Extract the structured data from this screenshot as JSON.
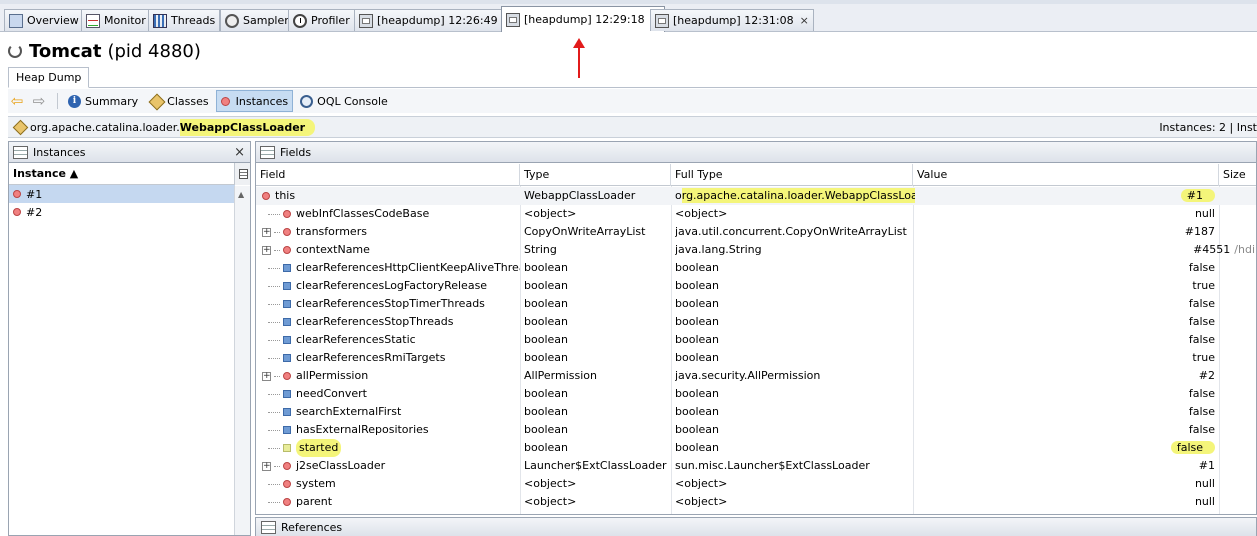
{
  "tabs": [
    {
      "label": "Overview",
      "icon": "overview-icon"
    },
    {
      "label": "Monitor",
      "icon": "monitor-icon"
    },
    {
      "label": "Threads",
      "icon": "threads-icon"
    },
    {
      "label": "Sampler",
      "icon": "sampler-icon"
    },
    {
      "label": "Profiler",
      "icon": "profiler-icon"
    },
    {
      "label": "[heapdump] 12:26:49",
      "icon": "heapdump-icon",
      "closable": true
    },
    {
      "label": "[heapdump] 12:29:18",
      "icon": "heapdump-icon",
      "closable": true,
      "active": true
    },
    {
      "label": "[heapdump] 12:31:08",
      "icon": "heapdump-icon",
      "closable": true
    }
  ],
  "tab_close_glyph": "×",
  "header": {
    "app_name": "Tomcat",
    "pid": "(pid 4880)"
  },
  "subtab": {
    "label": "Heap Dump"
  },
  "toolbar": {
    "back_glyph": "⇦",
    "forward_glyph": "⇨",
    "summary": "Summary",
    "classes": "Classes",
    "instances": "Instances",
    "oql": "OQL Console"
  },
  "classbar": {
    "package": "org.apache.catalina.loader.",
    "class_name": "WebappClassLoader",
    "instances_count": "Instances: 2  |  Inst"
  },
  "instances_panel": {
    "title": "Instances",
    "close_glyph": "×",
    "column": "Instance ▲",
    "rows": [
      "#1",
      "#2"
    ]
  },
  "fields_panel": {
    "title": "Fields",
    "columns": {
      "field": "Field",
      "type": "Type",
      "full_type": "Full Type",
      "value": "Value",
      "size": "Size"
    },
    "rows": [
      {
        "field": "this",
        "type": "WebappClassLoader",
        "full_type_prefix": "o",
        "full_type": "rg.apache.catalina.loader.WebappClassLoader",
        "value": "#1",
        "kind": "object",
        "expander": "none",
        "highlight": true
      },
      {
        "field": "webInfClassesCodeBase",
        "type": "<object>",
        "full_type": "<object>",
        "value": "null",
        "kind": "object",
        "expander": "none"
      },
      {
        "field": "transformers",
        "type": "CopyOnWriteArrayList",
        "full_type": "java.util.concurrent.CopyOnWriteArrayList",
        "value": "#187",
        "kind": "object",
        "expander": "+"
      },
      {
        "field": "contextName",
        "type": "String",
        "full_type": "java.lang.String",
        "value": "#4551",
        "value_extra": "/hdi",
        "kind": "object",
        "expander": "+"
      },
      {
        "field": "clearReferencesHttpClientKeepAliveThread",
        "type": "boolean",
        "full_type": "boolean",
        "value": "false",
        "kind": "primitive",
        "expander": "none"
      },
      {
        "field": "clearReferencesLogFactoryRelease",
        "type": "boolean",
        "full_type": "boolean",
        "value": "true",
        "kind": "primitive",
        "expander": "none"
      },
      {
        "field": "clearReferencesStopTimerThreads",
        "type": "boolean",
        "full_type": "boolean",
        "value": "false",
        "kind": "primitive",
        "expander": "none"
      },
      {
        "field": "clearReferencesStopThreads",
        "type": "boolean",
        "full_type": "boolean",
        "value": "false",
        "kind": "primitive",
        "expander": "none"
      },
      {
        "field": "clearReferencesStatic",
        "type": "boolean",
        "full_type": "boolean",
        "value": "false",
        "kind": "primitive",
        "expander": "none"
      },
      {
        "field": "clearReferencesRmiTargets",
        "type": "boolean",
        "full_type": "boolean",
        "value": "true",
        "kind": "primitive",
        "expander": "none"
      },
      {
        "field": "allPermission",
        "type": "AllPermission",
        "full_type": "java.security.AllPermission",
        "value": "#2",
        "kind": "object",
        "expander": "+"
      },
      {
        "field": "needConvert",
        "type": "boolean",
        "full_type": "boolean",
        "value": "false",
        "kind": "primitive",
        "expander": "none"
      },
      {
        "field": "searchExternalFirst",
        "type": "boolean",
        "full_type": "boolean",
        "value": "false",
        "kind": "primitive",
        "expander": "none"
      },
      {
        "field": "hasExternalRepositories",
        "type": "boolean",
        "full_type": "boolean",
        "value": "false",
        "kind": "primitive",
        "expander": "none"
      },
      {
        "field": "started",
        "type": "boolean",
        "full_type": "boolean",
        "value": "false",
        "kind": "primitive",
        "expander": "none",
        "highlight": true
      },
      {
        "field": "j2seClassLoader",
        "type": "Launcher$ExtClassLoader",
        "full_type": "sun.misc.Launcher$ExtClassLoader",
        "value": "#1",
        "kind": "object",
        "expander": "+"
      },
      {
        "field": "system",
        "type": "<object>",
        "full_type": "<object>",
        "value": "null",
        "kind": "object",
        "expander": "none"
      },
      {
        "field": "parent",
        "type": "<object>",
        "full_type": "<object>",
        "value": "null",
        "kind": "object",
        "expander": "none"
      }
    ]
  },
  "references_panel": {
    "title": "References"
  },
  "colors": {
    "highlight": "#f4f57a",
    "annotation_arrow": "#e21b1b",
    "selection": "#c5d8f0",
    "object_dot": "#f08080",
    "primitive_square": "#6f9bd4"
  }
}
